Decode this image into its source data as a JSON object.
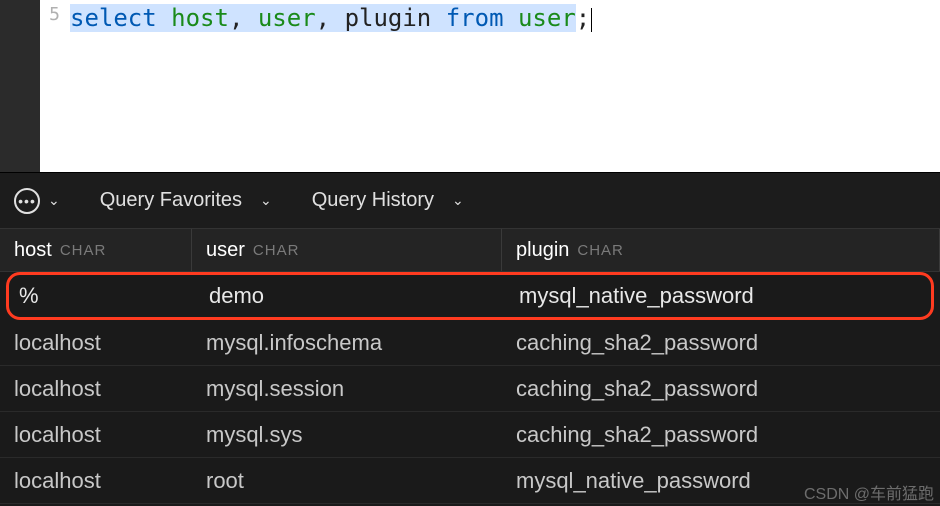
{
  "editor": {
    "line_number": "5",
    "tokens": {
      "select": "select",
      "host": "host",
      "comma1": ", ",
      "user1": "user",
      "comma2": ", ",
      "plugin": "plugin ",
      "from": "from",
      "space": " ",
      "user2": "user",
      "semi": ";"
    }
  },
  "toolbar": {
    "favorites_label": "Query Favorites",
    "history_label": "Query History"
  },
  "columns": {
    "host": {
      "name": "host",
      "type": "CHAR"
    },
    "user": {
      "name": "user",
      "type": "CHAR"
    },
    "plugin": {
      "name": "plugin",
      "type": "CHAR"
    }
  },
  "rows": [
    {
      "host": "%",
      "user": "demo",
      "plugin": "mysql_native_password",
      "highlighted": true
    },
    {
      "host": "localhost",
      "user": "mysql.infoschema",
      "plugin": "caching_sha2_password",
      "highlighted": false
    },
    {
      "host": "localhost",
      "user": "mysql.session",
      "plugin": "caching_sha2_password",
      "highlighted": false
    },
    {
      "host": "localhost",
      "user": "mysql.sys",
      "plugin": "caching_sha2_password",
      "highlighted": false
    },
    {
      "host": "localhost",
      "user": "root",
      "plugin": "mysql_native_password",
      "highlighted": false
    }
  ],
  "watermark": "CSDN @车前猛跑"
}
